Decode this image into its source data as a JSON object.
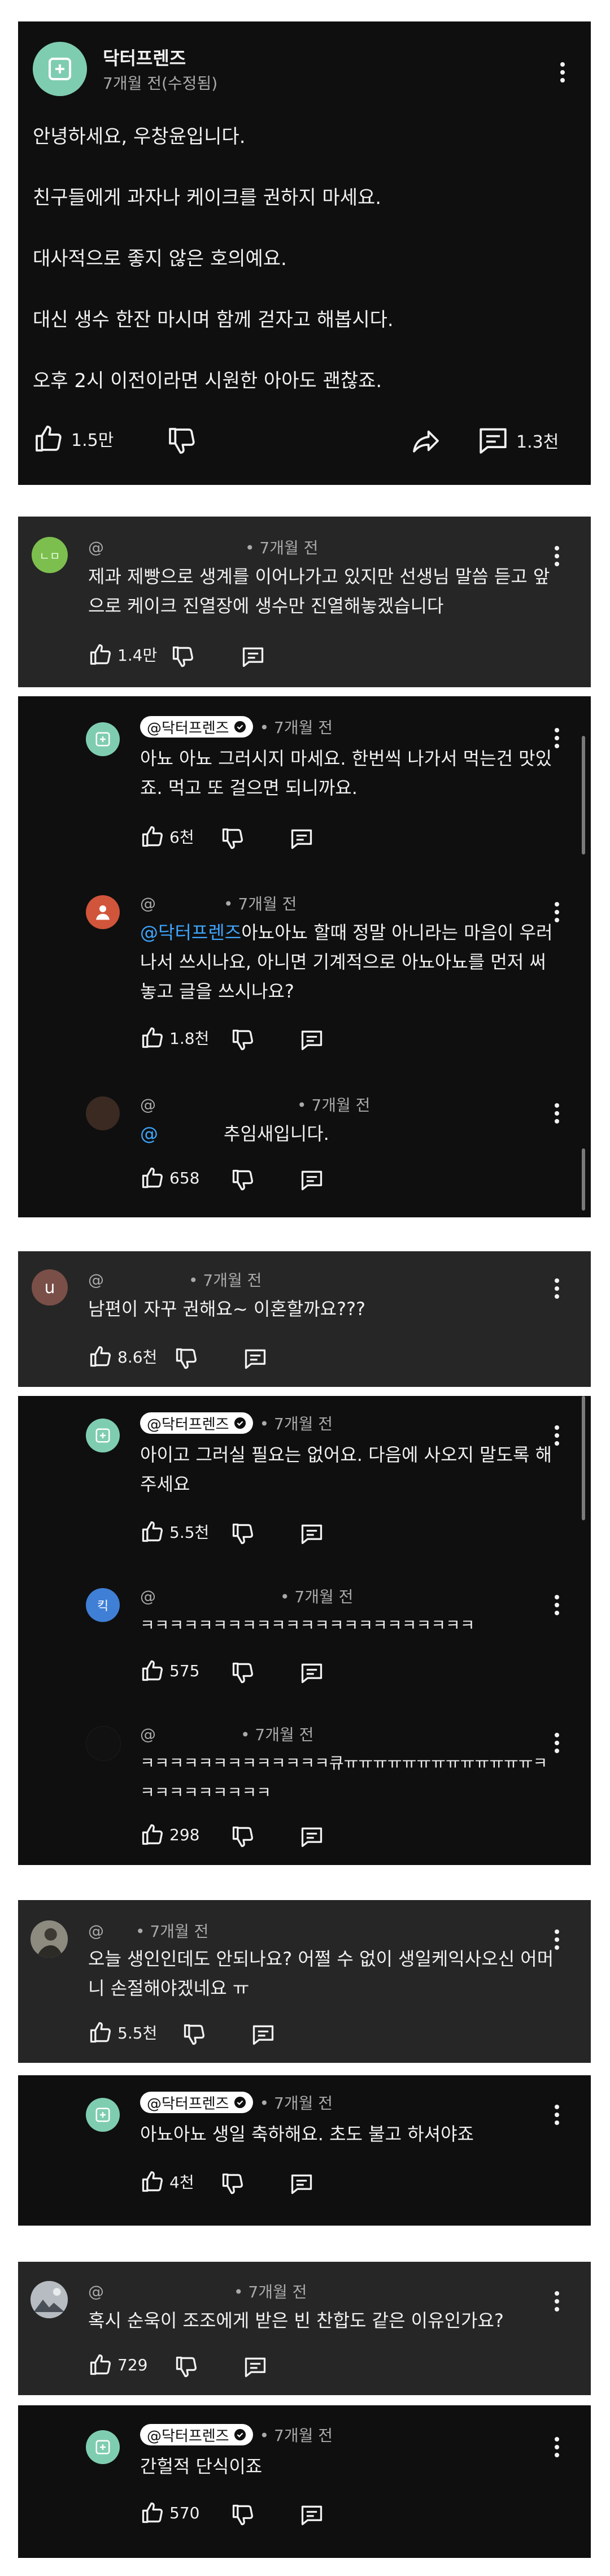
{
  "post": {
    "channel": "닥터프렌즈",
    "meta": "7개월 전(수정됨)",
    "lines": [
      "안녕하세요, 우창윤입니다.",
      "친구들에게 과자나 케이크를 권하지 마세요.",
      "대사적으로 좋지 않은 호의예요.",
      "대신 생수 한잔 마시며 함께 걷자고 해봅시다.",
      "오후 2시 이전이라면 시원한 아아도 괜찮죠."
    ],
    "likes": "1.5만",
    "comments": "1.3천"
  },
  "threads": [
    {
      "top": {
        "author": "@",
        "time": "• 7개월 전",
        "text": "제과 제빵으로 생계를 이어나가고 있지만 선생님 말씀 듣고 앞으로 케이크 진열장에 생수만 진열해놓겠습니다",
        "likes": "1.4만",
        "avatar_text": "ㄴㅁ",
        "avatar_color": "#7dbf4f"
      },
      "replies": [
        {
          "author": "@닥터프렌즈",
          "verified": true,
          "time": "• 7개월 전",
          "text": "아뇨 아뇨 그러시지 마세요. 한번씩 나가서 먹는건 맛있죠. 먹고 또 걸으면 되니까요.",
          "likes": "6천"
        },
        {
          "author": "@",
          "time": "• 7개월 전",
          "mention": "@닥터프렌즈",
          "text": "아뇨아뇨 할때 정말 아니라는 마음이 우러나서 쓰시나요, 아니면 기계적으로 아뇨아뇨를 먼저 써놓고 글을 쓰시나요?",
          "likes": "1.8천",
          "avatar_color": "#d0553a"
        },
        {
          "author": "@",
          "time": "• 7개월 전",
          "mention": "@",
          "text": "추임새입니다.",
          "likes": "658",
          "avatar_color": "#3a2a22"
        }
      ]
    },
    {
      "top": {
        "author": "@",
        "time": "• 7개월 전",
        "text": "남편이 자꾸 권해요~ 이혼할까요???",
        "likes": "8.6천",
        "avatar_text": "u",
        "avatar_color": "#7a4f47"
      },
      "replies": [
        {
          "author": "@닥터프렌즈",
          "verified": true,
          "time": "• 7개월 전",
          "text": "아이고 그러실 필요는 없어요. 다음에 사오지 말도록 해주세요",
          "likes": "5.5천"
        },
        {
          "author": "@",
          "time": "• 7개월 전",
          "text": "ㅋㅋㅋㅋㅋㅋㅋㅋㅋㅋㅋㅋㅋㅋㅋㅋㅋㅋㅋㅋㅋㅋㅋ",
          "likes": "575",
          "avatar_text": "킥",
          "avatar_color": "#3f7fd6"
        },
        {
          "author": "@",
          "time": "• 7개월 전",
          "text": "ㅋㅋㅋㅋㅋㅋㅋㅋㅋㅋㅋㅋㅋ큐ㅠㅠㅠㅠㅠㅠㅠㅠㅠㅠㅠㅠㅠㅋㅋㅋㅋㅋㅋㅋㅋㅋㅋ",
          "likes": "298",
          "avatar_color": "#111111"
        }
      ]
    },
    {
      "top": {
        "author": "@",
        "time": "• 7개월 전",
        "text": "오늘 생인인데도 안되나요? 어쩔 수 없이 생일케익사오신 어머니 손절해야겠네요 ㅠ",
        "likes": "5.5천",
        "avatar_color": "#6d6a62"
      },
      "replies": [
        {
          "author": "@닥터프렌즈",
          "verified": true,
          "time": "• 7개월 전",
          "text": "아뇨아뇨 생일 축하해요. 초도 불고 하셔야죠",
          "likes": "4천"
        }
      ]
    },
    {
      "top": {
        "author": "@",
        "time": "• 7개월 전",
        "text": "혹시 순욱이 조조에게 받은 빈 찬합도 같은 이유인가요?",
        "likes": "729",
        "avatar_color": "#8a8f96"
      },
      "replies": [
        {
          "author": "@닥터프렌즈",
          "verified": true,
          "time": "• 7개월 전",
          "text": "간헐적 단식이죠",
          "likes": "570"
        }
      ]
    }
  ],
  "icons": {
    "like": "thumbs-up-icon",
    "dislike": "thumbs-down-icon",
    "share": "share-icon",
    "comment": "comment-icon",
    "more": "more-vert-icon",
    "verified": "verified-check-icon",
    "channel": "doctor-friends-logo-icon"
  },
  "colors": {
    "background": "#0f0f0f",
    "comment_bg": "#262626",
    "link": "#3ea6ff",
    "muted": "#aaaaaa"
  }
}
